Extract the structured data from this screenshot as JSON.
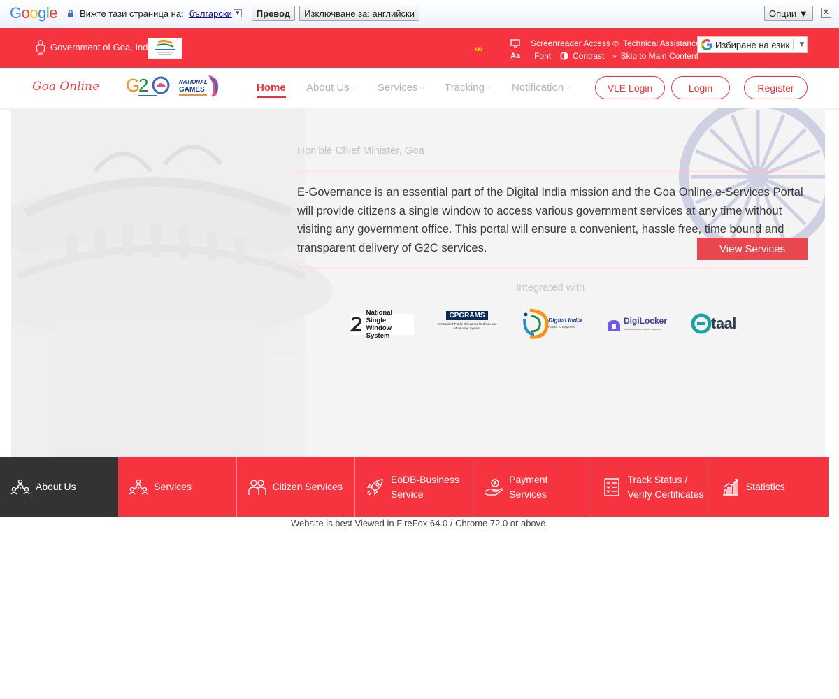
{
  "translate_bar": {
    "prompt": "Вижте тази страница на:",
    "language": "български",
    "translate_button": "Превод",
    "exclude_button": "Изключване за: английски",
    "options_button": "Опции ▼"
  },
  "header": {
    "gov_title": "Government of Goa, India",
    "screenreader": "Screenreader Access",
    "technical": "Technical Assistance",
    "font_icon": "Aa",
    "font": "Font",
    "contrast": "Contrast",
    "skip": "Skip to Main Content",
    "language_select": "Избиране на език"
  },
  "nav": {
    "brand": "Goa Online",
    "items": [
      {
        "label": "Home"
      },
      {
        "label": "About Us"
      },
      {
        "label": "Services"
      },
      {
        "label": "Tracking"
      },
      {
        "label": "Notification"
      }
    ],
    "vle_login": "VLE Login",
    "login": "Login",
    "register": "Register"
  },
  "hero": {
    "cm_title": "Hon'ble Chief Minister, Goa",
    "text": "E-Governance is an essential part of the Digital India mission and the Goa Online e-Services Portal will provide citizens a single window to access various government services at any time without visiting any government office. This portal will ensure a convenient, hassle free, time bound and transparent delivery of G2C services.",
    "view_services": "View Services",
    "integrated_with": "Integrated with",
    "partners": [
      {
        "name": "National Single Window System",
        "line1": "National Single",
        "line2": "Window System"
      },
      {
        "name": "CPGRAMS",
        "sub": "Centralized Public Grievance Redress and Monitoring System"
      },
      {
        "name": "Digital India",
        "sub": "Power To Empower"
      },
      {
        "name": "DigiLocker",
        "sub": "Your documents anytime anywhere"
      },
      {
        "name": "taal"
      }
    ]
  },
  "tiles": [
    {
      "label": "About Us",
      "icon": "people-network-icon"
    },
    {
      "label": "Services",
      "icon": "people-network-icon"
    },
    {
      "label": "Citizen Services",
      "icon": "citizens-icon"
    },
    {
      "label": "EoDB-Business Service",
      "icon": "rocket-icon"
    },
    {
      "label": "Payment Services",
      "icon": "payment-hand-icon"
    },
    {
      "label": "Track Status / Verify Certificates",
      "icon": "checklist-icon"
    },
    {
      "label": "Statistics",
      "icon": "bar-chart-icon"
    }
  ],
  "footer": {
    "note": "Website is best Viewed in FireFox 64.0 / Chrome 72.0 or above."
  },
  "colors": {
    "brand_red": "#f5343f",
    "dark_tile": "#333333",
    "link_blue": "#1a0dab"
  }
}
